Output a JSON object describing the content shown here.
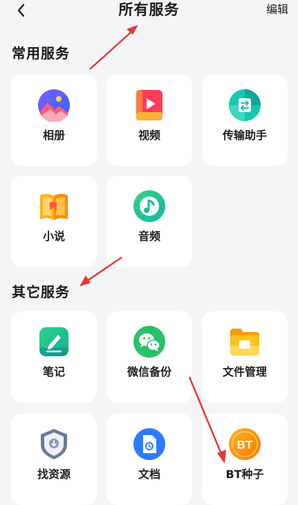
{
  "header": {
    "title": "所有服务",
    "edit_label": "编辑",
    "back_icon": "chevron-left-icon"
  },
  "sections": [
    {
      "title": "常用服务",
      "items": [
        {
          "label": "相册",
          "icon": "photo-album-icon"
        },
        {
          "label": "视频",
          "icon": "video-icon"
        },
        {
          "label": "传输助手",
          "icon": "transfer-assistant-icon"
        },
        {
          "label": "小说",
          "icon": "novel-book-icon"
        },
        {
          "label": "音频",
          "icon": "audio-music-icon"
        }
      ]
    },
    {
      "title": "其它服务",
      "items": [
        {
          "label": "笔记",
          "icon": "notes-pen-icon"
        },
        {
          "label": "微信备份",
          "icon": "wechat-backup-icon"
        },
        {
          "label": "文件管理",
          "icon": "file-folder-icon"
        },
        {
          "label": "找资源",
          "icon": "find-resources-shield-icon"
        },
        {
          "label": "文档",
          "icon": "document-icon"
        },
        {
          "label": "BT种子",
          "icon": "bt-torrent-icon",
          "icon_text": "BT"
        }
      ]
    }
  ],
  "colors": {
    "background": "#f4f5f7",
    "card": "#ffffff",
    "annotation_arrow": "#e53935"
  }
}
